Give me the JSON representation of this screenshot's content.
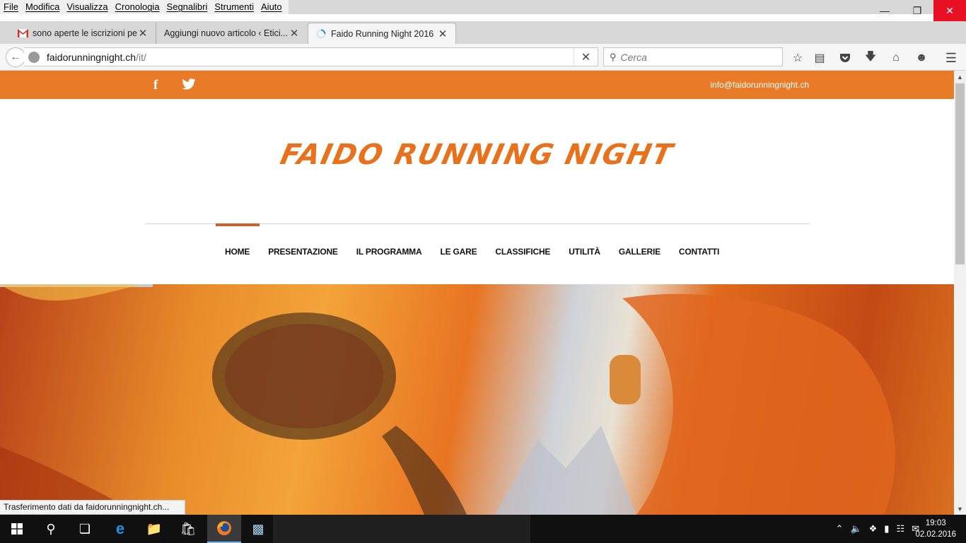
{
  "menubar": {
    "items": [
      "File",
      "Modifica",
      "Visualizza",
      "Cronologia",
      "Segnalibri",
      "Strumenti",
      "Aiuto"
    ]
  },
  "tabs": [
    {
      "title": "sono aperte le iscrizioni pe...",
      "icon": "gmail-icon",
      "active": false
    },
    {
      "title": "Aggiungi nuovo articolo ‹ Etici...",
      "icon": "wordpress-icon",
      "active": false
    },
    {
      "title": "Faido Running Night 2016",
      "icon": "loading-spinner-icon",
      "active": true
    }
  ],
  "navbar": {
    "url_host": "faidorunningnight.ch",
    "url_path": "/it/",
    "search_placeholder": "Cerca"
  },
  "site": {
    "email": "info@faidorunningnight.ch",
    "logo": "FAIDO RUNNING NIGHT",
    "nav": [
      "HOME",
      "PRESENTAZIONE",
      "IL PROGRAMMA",
      "LE GARE",
      "CLASSIFICHE",
      "UTILITÀ",
      "GALLERIE",
      "CONTATTI"
    ],
    "active_nav": "HOME",
    "accent_color": "#e87a28"
  },
  "status": "Trasferimento dati da faidorunningnight.ch...",
  "clock": {
    "time": "19:03",
    "date": "02.02.2016"
  }
}
